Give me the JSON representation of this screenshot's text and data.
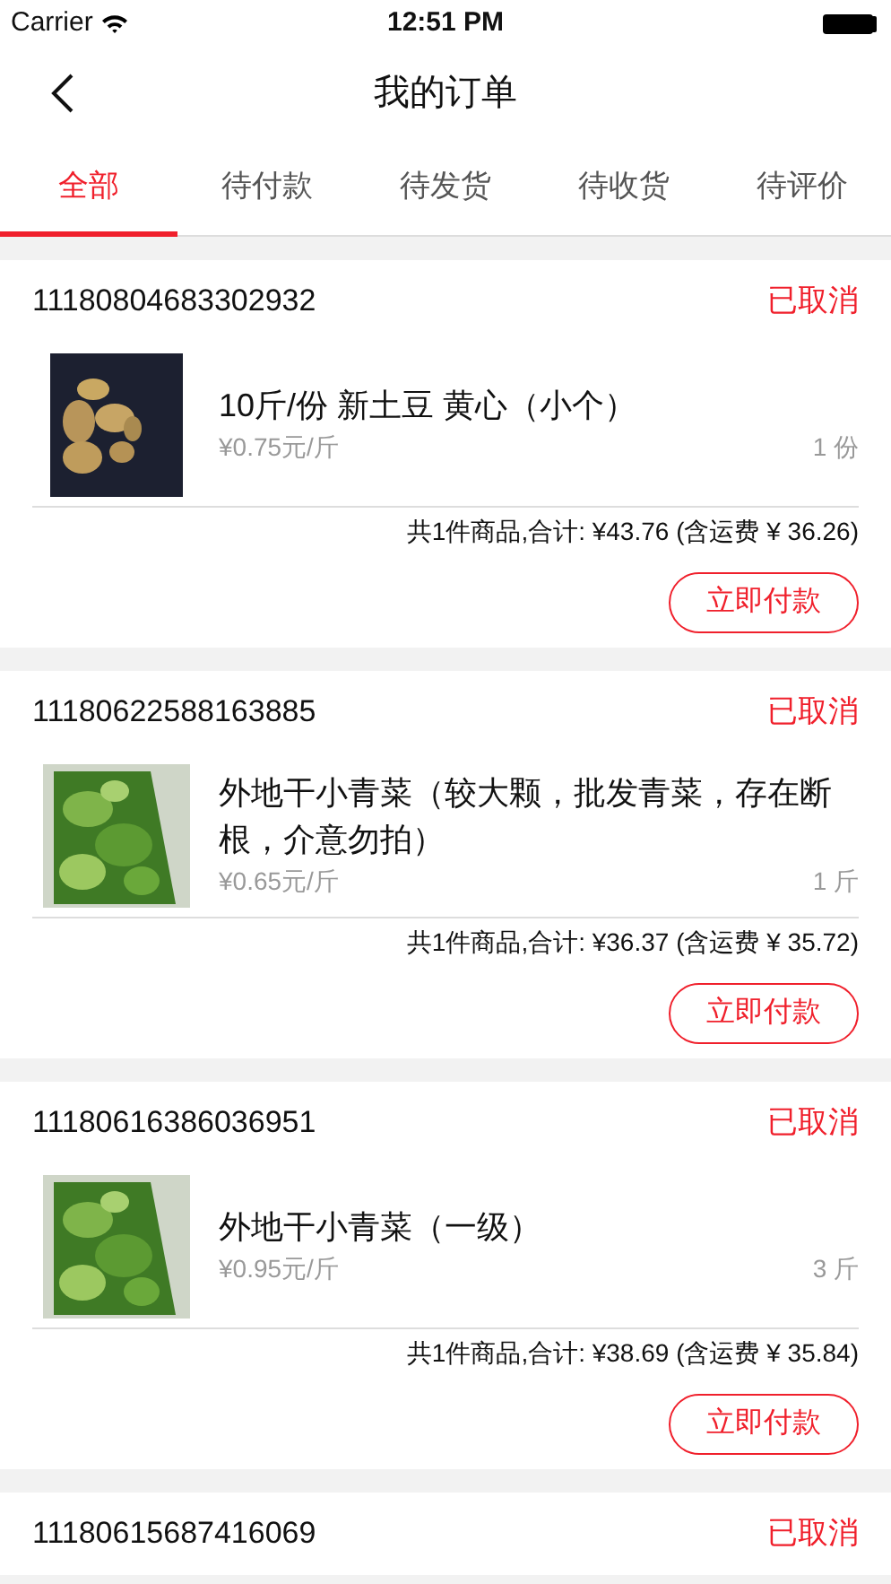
{
  "status_bar": {
    "carrier": "Carrier",
    "time": "12:51 PM"
  },
  "nav": {
    "title": "我的订单"
  },
  "tabs": [
    {
      "label": "全部",
      "selected": true
    },
    {
      "label": "待付款",
      "selected": false
    },
    {
      "label": "待发货",
      "selected": false
    },
    {
      "label": "待收货",
      "selected": false
    },
    {
      "label": "待评价",
      "selected": false
    }
  ],
  "orders": [
    {
      "number": "11180804683302932",
      "status": "已取消",
      "items": [
        {
          "name": "10斤/份 新土豆 黄心（小个）",
          "price": "¥0.75元/斤",
          "quantity": "1 份"
        }
      ],
      "summary": "共1件商品,合计: ¥43.76 (含运费 ¥ 36.26)",
      "button": "立即付款"
    },
    {
      "number": "11180622588163885",
      "status": "已取消",
      "items": [
        {
          "name": "外地干小青菜（较大颗，批发青菜，存在断根，介意勿拍）",
          "price": "¥0.65元/斤",
          "quantity": "1 斤"
        }
      ],
      "summary": "共1件商品,合计: ¥36.37 (含运费 ¥ 35.72)",
      "button": "立即付款"
    },
    {
      "number": "11180616386036951",
      "status": "已取消",
      "items": [
        {
          "name": "外地干小青菜（一级）",
          "price": "¥0.95元/斤",
          "quantity": "3 斤"
        }
      ],
      "summary": "共1件商品,合计: ¥38.69 (含运费 ¥ 35.84)",
      "button": "立即付款"
    },
    {
      "number": "11180615687416069",
      "status": "已取消"
    }
  ]
}
